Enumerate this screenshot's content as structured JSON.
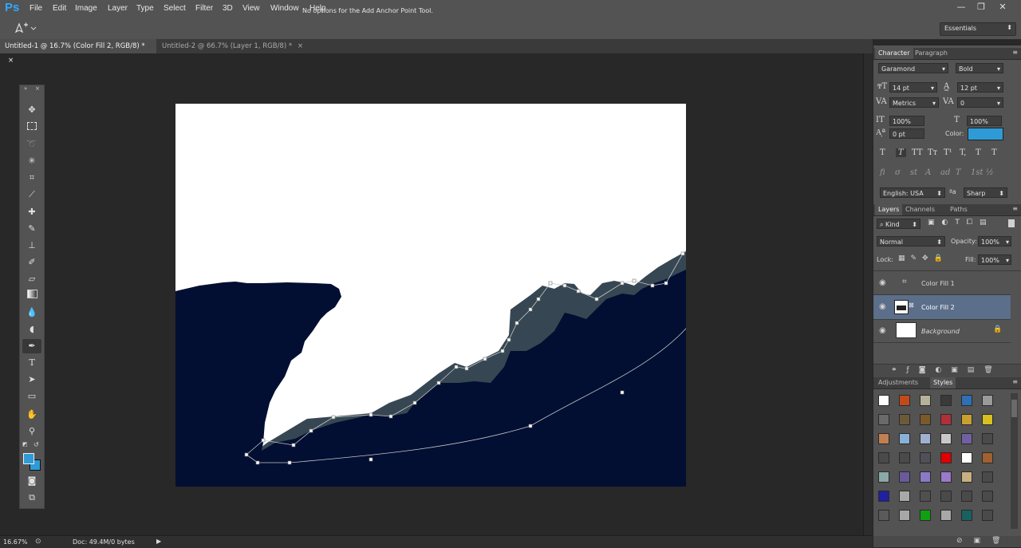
{
  "app": {
    "logo": "Ps"
  },
  "menu": [
    "File",
    "Edit",
    "Image",
    "Layer",
    "Type",
    "Select",
    "Filter",
    "3D",
    "View",
    "Window",
    "Help"
  ],
  "window_controls": {
    "minimize": "—",
    "restore": "❐",
    "close": "✕"
  },
  "options_bar": {
    "text": "No options for the Add Anchor Point Tool.",
    "workspace": "Essentials"
  },
  "doc_tabs": [
    {
      "label": "Untitled-1 @ 16.7% (Color Fill 2, RGB/8) *",
      "close": "×"
    },
    {
      "label": "Untitled-2 @ 66.7% (Layer 1, RGB/8) *",
      "close": "×"
    }
  ],
  "status": {
    "zoom": "16.67%",
    "doc": "Doc: 49.4M/0 bytes"
  },
  "colors": {
    "foreground": "#2f9bd6",
    "background": "#2f9bd6",
    "navy": "#020f32",
    "slate": "#364753",
    "canvas": "#ffffff",
    "selected_layer": "#5b6e8a"
  },
  "character_panel": {
    "tabs": [
      "Character",
      "Paragraph"
    ],
    "font_family": "Garamond",
    "font_style": "Bold",
    "size": "14 pt",
    "leading": "12 pt",
    "kerning": "Metrics",
    "tracking": "0",
    "vscale": "100%",
    "hscale": "100%",
    "baseline": "0 pt",
    "color_label": "Color:",
    "type_styles": [
      "T",
      "T",
      "TT",
      "Tт",
      "T¹",
      "T,",
      "T",
      "T"
    ],
    "opentype": [
      "fi",
      "σ",
      "st",
      "A",
      "ad",
      "T",
      "1st",
      "½"
    ],
    "language": "English: USA",
    "aa_label": "a",
    "antialias": "Sharp"
  },
  "layers_panel": {
    "tabs": [
      "Layers",
      "Channels",
      "Paths"
    ],
    "kind": "Kind",
    "blend": "Normal",
    "opacity_label": "Opacity:",
    "opacity": "100%",
    "lock_label": "Lock:",
    "fill_label": "Fill:",
    "fill": "100%",
    "layers": [
      {
        "name": "Color Fill 1",
        "selected": false
      },
      {
        "name": "Color Fill 2",
        "selected": true
      },
      {
        "name": "Background",
        "selected": false
      }
    ]
  },
  "adjustments_panel": {
    "tabs": [
      "Adjustments",
      "Styles"
    ]
  },
  "styles": [
    "#ffffff",
    "#c24a1a",
    "#b5b29a",
    "#3a3a3a",
    "#2f6fb5",
    "#9a9a9a",
    "#6a6a6a",
    "#6b5a3a",
    "#7a5a2a",
    "#b0303a",
    "#c8a030",
    "#d8c020",
    "#c08050",
    "#8ab0d8",
    "#a0b0d0",
    "#c8c8c8",
    "#7060a0",
    "#4a4a4a",
    "#4a4a4a",
    "#4a4a4a",
    "#505058",
    "#e00000",
    "#ffffff",
    "#a06030",
    "#8aa8a8",
    "#6a5a9a",
    "#8a7ac8",
    "#9a7ac8",
    "#c8b080",
    "#4a4a4a",
    "#2020a0",
    "#a8a8a8",
    "#505050",
    "#4a4a4a",
    "#4a4a4a",
    "#4a4a4a",
    "#5a5a5a",
    "#a8a8a8",
    "#10a010",
    "#a8a8a8",
    "#1a6060",
    "#4a4a4a"
  ]
}
